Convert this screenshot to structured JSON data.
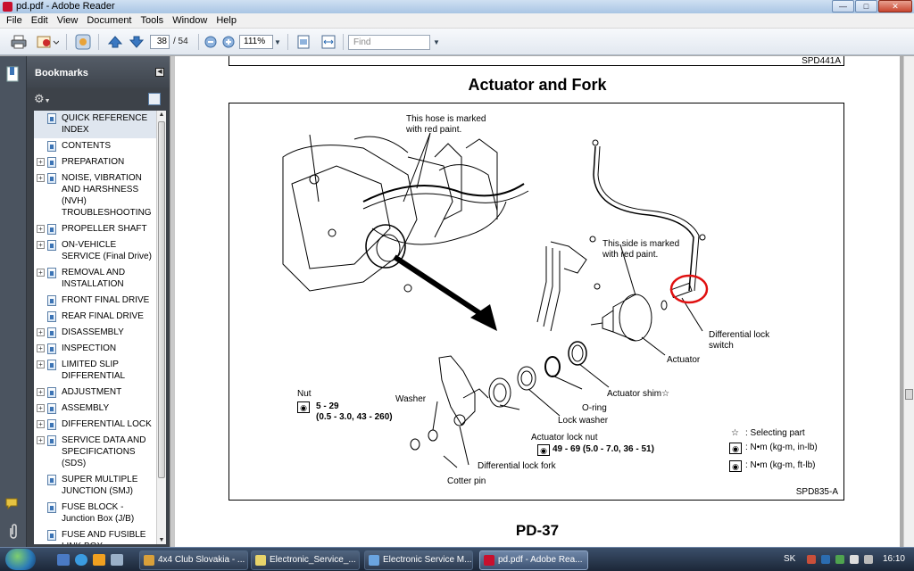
{
  "window": {
    "title": "pd.pdf - Adobe Reader"
  },
  "menu": [
    "File",
    "Edit",
    "View",
    "Document",
    "Tools",
    "Window",
    "Help"
  ],
  "toolbar": {
    "page_current": "38",
    "page_total": "/ 54",
    "zoom": "111%",
    "find_placeholder": "Find"
  },
  "bookmarks": {
    "title": "Bookmarks",
    "items": [
      {
        "label": "QUICK REFERENCE INDEX",
        "expandable": false,
        "selected": true
      },
      {
        "label": "CONTENTS",
        "expandable": false
      },
      {
        "label": "PREPARATION",
        "expandable": true
      },
      {
        "label": "NOISE, VIBRATION AND HARSHNESS (NVH) TROUBLESHOOTING",
        "expandable": true
      },
      {
        "label": "PROPELLER SHAFT",
        "expandable": true
      },
      {
        "label": "ON-VEHICLE SERVICE (Final Drive)",
        "expandable": true
      },
      {
        "label": "REMOVAL AND INSTALLATION",
        "expandable": true
      },
      {
        "label": "FRONT FINAL DRIVE",
        "expandable": false
      },
      {
        "label": "REAR FINAL DRIVE",
        "expandable": false
      },
      {
        "label": "DISASSEMBLY",
        "expandable": true
      },
      {
        "label": "INSPECTION",
        "expandable": true
      },
      {
        "label": "LIMITED SLIP DIFFERENTIAL",
        "expandable": true
      },
      {
        "label": "ADJUSTMENT",
        "expandable": true
      },
      {
        "label": "ASSEMBLY",
        "expandable": true
      },
      {
        "label": "DIFFERENTIAL LOCK",
        "expandable": true
      },
      {
        "label": "SERVICE DATA AND SPECIFICATIONS (SDS)",
        "expandable": true
      },
      {
        "label": "SUPER MULTIPLE JUNCTION (SMJ)",
        "expandable": false
      },
      {
        "label": "FUSE BLOCK - Junction Box (J/B)",
        "expandable": false
      },
      {
        "label": "FUSE AND FUSIBLE LINK BOX",
        "expandable": false
      }
    ]
  },
  "document": {
    "top_code": "SPD441A",
    "page_title": "Actuator and Fork",
    "figure_code": "SPD835-A",
    "footer": "PD-37",
    "labels": {
      "hose_note_1": "This hose is marked",
      "hose_note_2": "with red paint.",
      "side_note_1": "This side is marked",
      "side_note_2": "with red paint.",
      "diff_switch_1": "Differential lock",
      "diff_switch_2": "switch",
      "actuator": "Actuator",
      "actuator_shim": "Actuator shim☆",
      "o_ring": "O-ring",
      "lock_washer": "Lock washer",
      "actuator_lock_nut": "Actuator lock nut",
      "nut_torque_1": "49 - 69 (5.0 - 7.0, 36 - 51)",
      "nut": "Nut",
      "nut_torque_a": "5 - 29",
      "nut_torque_b": "(0.5 - 3.0, 43 - 260)",
      "washer": "Washer",
      "diff_lock_fork": "Differential lock fork",
      "cotter_pin": "Cotter pin",
      "legend_selecting": ": Selecting part",
      "legend_inlb": ": N•m (kg-m, in-lb)",
      "legend_ftlb": ": N•m (kg-m, ft-lb)",
      "legend_star": "☆"
    }
  },
  "taskbar": {
    "tasks": [
      {
        "label": "4x4 Club Slovakia - ...",
        "color": "#d9a03a"
      },
      {
        "label": "Electronic_Service_...",
        "color": "#e8d46a"
      },
      {
        "label": "Electronic Service M...",
        "color": "#6aa4e0"
      },
      {
        "label": "pd.pdf - Adobe Rea...",
        "color": "#c8102e",
        "active": true
      }
    ],
    "lang": "SK",
    "clock": "16:10"
  }
}
